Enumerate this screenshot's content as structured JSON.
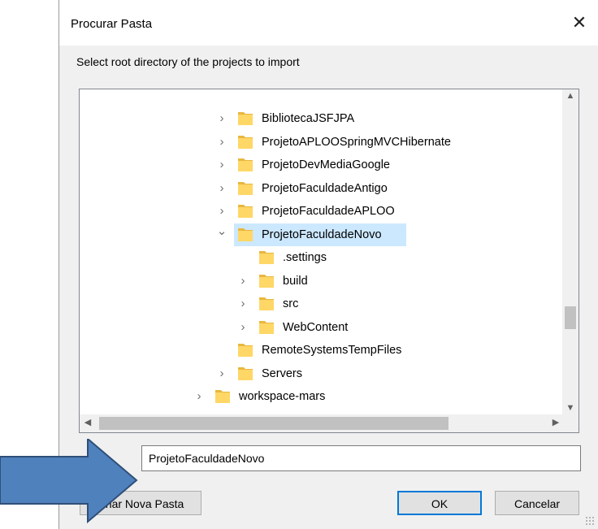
{
  "window": {
    "title": "Procurar Pasta",
    "close_symbol": "✕"
  },
  "instruction": "Select root directory of the projects to import",
  "tree": {
    "items": [
      {
        "label": "BibliotecaJSFJPA",
        "level": 1,
        "chevron": "›",
        "selected": false
      },
      {
        "label": "ProjetoAPLOOSpringMVCHibernate",
        "level": 1,
        "chevron": "›",
        "selected": false
      },
      {
        "label": "ProjetoDevMediaGoogle",
        "level": 1,
        "chevron": "›",
        "selected": false
      },
      {
        "label": "ProjetoFaculdadeAntigo",
        "level": 1,
        "chevron": "›",
        "selected": false
      },
      {
        "label": "ProjetoFaculdadeAPLOO",
        "level": 1,
        "chevron": "›",
        "selected": false
      },
      {
        "label": "ProjetoFaculdadeNovo",
        "level": 1,
        "chevron": "⌄",
        "selected": true
      },
      {
        "label": ".settings",
        "level": 2,
        "chevron": "",
        "selected": false
      },
      {
        "label": "build",
        "level": 2,
        "chevron": "›",
        "selected": false
      },
      {
        "label": "src",
        "level": 2,
        "chevron": "›",
        "selected": false
      },
      {
        "label": "WebContent",
        "level": 2,
        "chevron": "›",
        "selected": false
      },
      {
        "label": "RemoteSystemsTempFiles",
        "level": 1,
        "chevron": "",
        "selected": false
      },
      {
        "label": "Servers",
        "level": 1,
        "chevron": "›",
        "selected": false
      },
      {
        "label": "workspace-mars",
        "level": 0,
        "chevron": "›",
        "selected": false
      }
    ]
  },
  "folder_input": {
    "value": "ProjetoFaculdadeNovo"
  },
  "buttons": {
    "new_folder": "Criar Nova Pasta",
    "ok": "OK",
    "cancel": "Cancelar"
  },
  "colors": {
    "selection": "#cce8ff",
    "folder": "#ffd766",
    "accent": "#0078d7",
    "overlay_arrow": "#4f81bd"
  },
  "icons": {
    "folder": "folder-icon",
    "close": "close-icon",
    "expand": "chevron-right-icon",
    "collapse": "chevron-down-icon"
  }
}
